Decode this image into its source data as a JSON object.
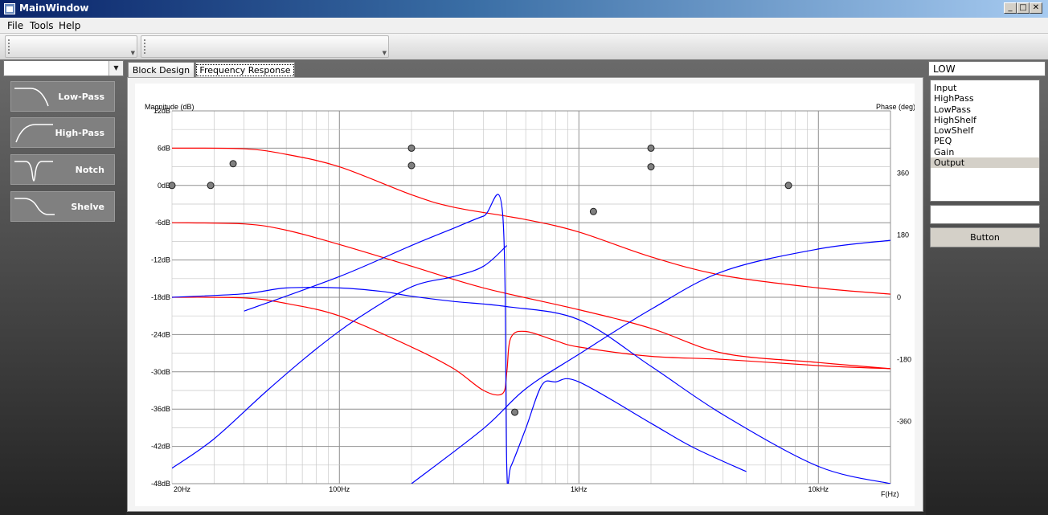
{
  "window": {
    "title": "MainWindow",
    "controls": [
      "_",
      "□",
      "✕"
    ]
  },
  "menu": {
    "file": "File",
    "tools": "Tools",
    "help": "Help"
  },
  "left_panel": {
    "combo_value": "",
    "filters": [
      {
        "label": "Low-Pass",
        "icon": "lowpass-curve-icon"
      },
      {
        "label": "High-Pass",
        "icon": "highpass-curve-icon"
      },
      {
        "label": "Notch",
        "icon": "notch-curve-icon"
      },
      {
        "label": "Shelve",
        "icon": "shelve-curve-icon"
      }
    ]
  },
  "tabs": {
    "block_design": "Block Design",
    "frequency_response": "Frequency Response"
  },
  "plot": {
    "y_title": "Magnitude (dB)",
    "y2_title": "Phase (deg)",
    "x_title": "F(Hz)",
    "magnitude_ticks": [
      "12dB",
      "6dB",
      "0dB",
      "-6dB",
      "-12dB",
      "-18dB",
      "-24dB",
      "-30dB",
      "-36dB",
      "-42dB",
      "-48dB"
    ],
    "phase_ticks": [
      "360",
      "180",
      "0",
      "-180",
      "-360"
    ],
    "freq_ticks": [
      "20Hz",
      "100Hz",
      "1kHz",
      "10kHz"
    ],
    "colors": {
      "magnitude": "#ff0000",
      "phase": "#0000ff",
      "points": "#808080",
      "grid": "#c8c8c8",
      "grid_major": "#909090"
    }
  },
  "chart_data": {
    "type": "line",
    "x_scale": "log",
    "xlim": [
      20,
      20000
    ],
    "ylim": [
      -48,
      12
    ],
    "y2lim": [
      -540,
      540
    ],
    "xlabel": "F(Hz)",
    "ylabel": "Magnitude (dB)",
    "y2label": "Phase (deg)",
    "grid": true,
    "series": [
      {
        "kind": "magnitude",
        "axis": "left",
        "x": [
          20,
          40,
          60,
          100,
          200,
          300,
          600,
          1000,
          2000,
          4000,
          10000,
          20000
        ],
        "y": [
          6,
          5.9,
          5,
          3,
          -1.5,
          -3.5,
          -5.5,
          -7.5,
          -11.5,
          -14.5,
          -16.5,
          -17.5
        ]
      },
      {
        "kind": "magnitude",
        "axis": "left",
        "x": [
          20,
          40,
          60,
          100,
          200,
          400,
          1000,
          2000,
          4000,
          10000,
          20000
        ],
        "y": [
          -6,
          -6.2,
          -7.2,
          -9.5,
          -13,
          -16.5,
          -20,
          -23,
          -27,
          -28.5,
          -29.5
        ]
      },
      {
        "kind": "magnitude",
        "axis": "left",
        "x": [
          20,
          40,
          60,
          100,
          200,
          300,
          400,
          480,
          500,
          520,
          600,
          800,
          1000,
          2000,
          4000,
          10000,
          20000
        ],
        "y": [
          -18,
          -18.1,
          -19,
          -21,
          -26,
          -29.5,
          -33,
          -33.5,
          -30,
          -24.5,
          -23.5,
          -25,
          -26,
          -27.5,
          -28,
          -29,
          -29.5
        ]
      },
      {
        "kind": "phase",
        "axis": "right",
        "x": [
          20,
          30,
          50,
          80,
          120,
          200,
          300,
          400,
          500
        ],
        "y": [
          -495,
          -410,
          -270,
          -150,
          -60,
          30,
          60,
          90,
          150
        ]
      },
      {
        "kind": "phase",
        "axis": "right",
        "x": [
          20,
          40,
          60,
          100,
          150,
          200,
          300,
          500,
          1000,
          2000,
          4000,
          10000,
          20000
        ],
        "y": [
          0,
          10,
          27,
          27,
          17,
          3,
          -12,
          -27,
          -65,
          -200,
          -340,
          -490,
          -540
        ]
      },
      {
        "kind": "phase",
        "axis": "right",
        "x": [
          40,
          100,
          200,
          300,
          400,
          480,
          500,
          520,
          600,
          700,
          800,
          1000,
          2000,
          3000,
          5000
        ],
        "y": [
          -40,
          60,
          150,
          200,
          235,
          245,
          -495,
          -490,
          -380,
          -255,
          -245,
          -245,
          -365,
          -435,
          -505
        ]
      },
      {
        "kind": "phase",
        "axis": "right",
        "x": [
          200,
          400,
          600,
          1000,
          2000,
          4000,
          10000,
          20000
        ],
        "y": [
          -540,
          -380,
          -265,
          -165,
          -35,
          75,
          140,
          165
        ]
      }
    ],
    "points": [
      {
        "x": 20,
        "y": 0
      },
      {
        "x": 29,
        "y": 0
      },
      {
        "x": 36,
        "y": 3.5
      },
      {
        "x": 200,
        "y": 6
      },
      {
        "x": 200,
        "y": 3.2
      },
      {
        "x": 540,
        "y": -36.5
      },
      {
        "x": 1150,
        "y": -4.2
      },
      {
        "x": 2000,
        "y": 6
      },
      {
        "x": 2000,
        "y": 3
      },
      {
        "x": 7500,
        "y": 0
      }
    ]
  },
  "right_panel": {
    "selected_value": "LOW",
    "list_items": [
      "Input",
      "HighPass",
      "LowPass",
      "HighShelf",
      "LowShelf",
      "PEQ",
      "Gain",
      "Output"
    ],
    "selected_index": 7,
    "text_value": "",
    "button_label": "Button"
  }
}
